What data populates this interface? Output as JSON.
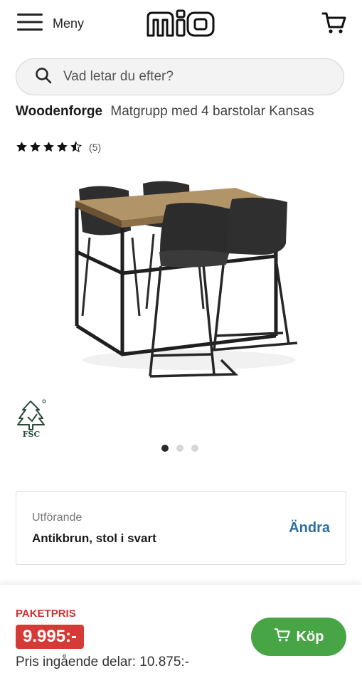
{
  "header": {
    "menu_label": "Meny",
    "logo_text": "mio"
  },
  "search": {
    "placeholder": "Vad letar du efter?"
  },
  "product": {
    "brand": "Woodenforge",
    "name": "Matgrupp med 4 barstolar Kansas",
    "rating": 4.5,
    "review_count": "(5)",
    "certification": "FSC"
  },
  "carousel": {
    "total": 3,
    "active": 1
  },
  "variant": {
    "label": "Utförande",
    "value": "Antikbrun, stol i svart",
    "change_label": "Ändra"
  },
  "pricing": {
    "label": "PAKETPRIS",
    "price": "9.995:-",
    "components_price": "Pris ingående delar: 10.875:-",
    "buy_label": "Köp"
  },
  "colors": {
    "buy_button": "#48a546",
    "price_badge": "#d63a36",
    "change_link": "#2f6f9f"
  }
}
